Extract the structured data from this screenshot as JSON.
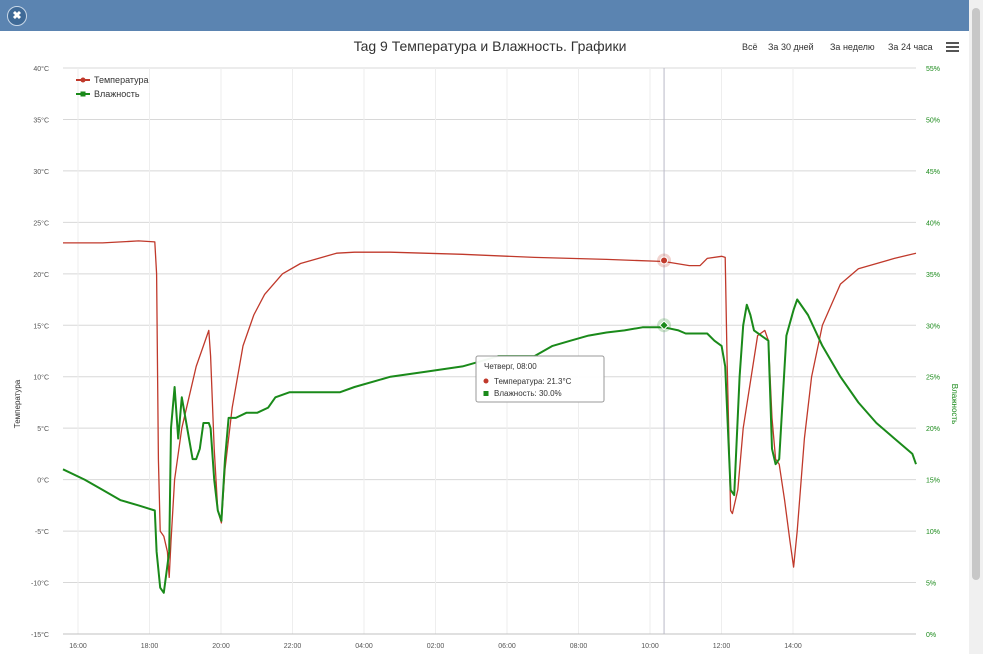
{
  "window": {
    "close_glyph": "✖"
  },
  "toolbar": {
    "range_buttons": [
      "Всё",
      "За 30 дней",
      "За неделю",
      "За 24 часа"
    ],
    "menu_icon": "hamburger-menu-icon"
  },
  "chart_data": {
    "type": "line",
    "title": "Tag 9 Температура и Влажность. Графики",
    "ylabel_left": "Температура",
    "ylabel_right": "Влажность",
    "x_ticks": [
      "16:00",
      "18:00",
      "20:00",
      "22:00",
      "04:00",
      "02:00",
      "06:00",
      "08:00",
      "10:00",
      "12:00",
      "14:00"
    ],
    "y_left": {
      "min": -15,
      "max": 40,
      "step": 5,
      "ticks": [
        "-15°C",
        "-10°C",
        "-5°C",
        "0°C",
        "5°C",
        "10°C",
        "15°C",
        "20°C",
        "25°C",
        "30°C",
        "35°C",
        "40°C"
      ]
    },
    "y_right": {
      "min": 0,
      "max": 55,
      "step": 5,
      "ticks": [
        "0%",
        "5%",
        "10%",
        "15%",
        "20%",
        "25%",
        "30%",
        "35%",
        "40%",
        "45%",
        "50%",
        "55%"
      ]
    },
    "x_range": [
      14.9,
      38.6
    ],
    "grid": true,
    "legend_position": "top-left",
    "series": [
      {
        "name": "Температура",
        "color": "#c0392b",
        "axis": "left",
        "points": [
          [
            14.9,
            23.0
          ],
          [
            16.0,
            23.0
          ],
          [
            17.0,
            23.2
          ],
          [
            17.45,
            23.1
          ],
          [
            17.5,
            20.0
          ],
          [
            17.55,
            2.0
          ],
          [
            17.6,
            -5.0
          ],
          [
            17.7,
            -5.5
          ],
          [
            17.8,
            -7.0
          ],
          [
            17.85,
            -9.5
          ],
          [
            17.9,
            -6.0
          ],
          [
            18.0,
            0.0
          ],
          [
            18.2,
            5.0
          ],
          [
            18.4,
            8.0
          ],
          [
            18.6,
            11.0
          ],
          [
            18.8,
            13.0
          ],
          [
            18.95,
            14.5
          ],
          [
            19.0,
            12.0
          ],
          [
            19.1,
            3.0
          ],
          [
            19.2,
            -3.0
          ],
          [
            19.3,
            -4.2
          ],
          [
            19.4,
            1.0
          ],
          [
            19.6,
            7.0
          ],
          [
            19.9,
            13.0
          ],
          [
            20.2,
            16.0
          ],
          [
            20.5,
            18.0
          ],
          [
            21.0,
            20.0
          ],
          [
            21.5,
            21.0
          ],
          [
            22.0,
            21.5
          ],
          [
            22.5,
            22.0
          ],
          [
            23.0,
            22.1
          ],
          [
            24.0,
            22.1
          ],
          [
            26.0,
            21.9
          ],
          [
            28.0,
            21.6
          ],
          [
            30.0,
            21.4
          ],
          [
            31.6,
            21.2
          ],
          [
            32.3,
            20.8
          ],
          [
            32.6,
            20.8
          ],
          [
            32.8,
            21.5
          ],
          [
            33.2,
            21.7
          ],
          [
            33.3,
            21.6
          ],
          [
            33.35,
            12.0
          ],
          [
            33.45,
            -3.0
          ],
          [
            33.5,
            -3.3
          ],
          [
            33.65,
            -1.0
          ],
          [
            33.8,
            5.0
          ],
          [
            34.0,
            9.5
          ],
          [
            34.2,
            14.0
          ],
          [
            34.4,
            14.5
          ],
          [
            34.5,
            13.5
          ],
          [
            34.6,
            6.0
          ],
          [
            34.7,
            2.0
          ],
          [
            34.8,
            1.5
          ],
          [
            34.95,
            -2.0
          ],
          [
            35.1,
            -6.0
          ],
          [
            35.2,
            -8.5
          ],
          [
            35.3,
            -5.0
          ],
          [
            35.5,
            4.0
          ],
          [
            35.7,
            10.0
          ],
          [
            36.0,
            15.0
          ],
          [
            36.5,
            19.0
          ],
          [
            37.0,
            20.5
          ],
          [
            38.0,
            21.5
          ],
          [
            39.0,
            22.0
          ],
          [
            40.0,
            22.5
          ],
          [
            41.0,
            22.8
          ],
          [
            42.0,
            23.0
          ]
        ]
      },
      {
        "name": "Влажность",
        "color": "#1a8a1a",
        "axis": "right",
        "points": [
          [
            14.9,
            16.0
          ],
          [
            15.5,
            15.0
          ],
          [
            16.0,
            14.0
          ],
          [
            16.5,
            13.0
          ],
          [
            17.0,
            12.5
          ],
          [
            17.45,
            12.0
          ],
          [
            17.5,
            8.0
          ],
          [
            17.6,
            4.5
          ],
          [
            17.7,
            4.0
          ],
          [
            17.85,
            8.0
          ],
          [
            17.9,
            20.0
          ],
          [
            18.0,
            24.0
          ],
          [
            18.1,
            19.0
          ],
          [
            18.2,
            23.0
          ],
          [
            18.35,
            20.0
          ],
          [
            18.5,
            17.0
          ],
          [
            18.6,
            17.0
          ],
          [
            18.7,
            18.0
          ],
          [
            18.8,
            20.5
          ],
          [
            18.95,
            20.5
          ],
          [
            19.0,
            20.0
          ],
          [
            19.1,
            15.0
          ],
          [
            19.2,
            12.0
          ],
          [
            19.3,
            11.0
          ],
          [
            19.4,
            17.0
          ],
          [
            19.5,
            21.0
          ],
          [
            19.7,
            21.0
          ],
          [
            20.0,
            21.5
          ],
          [
            20.3,
            21.5
          ],
          [
            20.6,
            22.0
          ],
          [
            20.8,
            23.0
          ],
          [
            21.2,
            23.5
          ],
          [
            22.0,
            23.5
          ],
          [
            22.6,
            23.5
          ],
          [
            23.0,
            24.0
          ],
          [
            24.0,
            25.0
          ],
          [
            25.0,
            25.5
          ],
          [
            26.0,
            26.0
          ],
          [
            26.5,
            26.5
          ],
          [
            27.0,
            27.0
          ],
          [
            28.0,
            27.0
          ],
          [
            28.5,
            28.0
          ],
          [
            29.0,
            28.5
          ],
          [
            29.5,
            29.0
          ],
          [
            30.0,
            29.3
          ],
          [
            30.5,
            29.5
          ],
          [
            31.0,
            29.8
          ],
          [
            31.6,
            29.8
          ],
          [
            32.0,
            29.5
          ],
          [
            32.2,
            29.2
          ],
          [
            32.5,
            29.2
          ],
          [
            32.8,
            29.2
          ],
          [
            33.0,
            28.5
          ],
          [
            33.2,
            28.0
          ],
          [
            33.3,
            26.0
          ],
          [
            33.45,
            14.0
          ],
          [
            33.55,
            13.5
          ],
          [
            33.7,
            25.0
          ],
          [
            33.8,
            30.0
          ],
          [
            33.9,
            32.0
          ],
          [
            34.0,
            31.0
          ],
          [
            34.1,
            29.5
          ],
          [
            34.3,
            29.0
          ],
          [
            34.5,
            28.5
          ],
          [
            34.6,
            18.0
          ],
          [
            34.7,
            16.5
          ],
          [
            34.8,
            17.0
          ],
          [
            34.9,
            23.0
          ],
          [
            35.0,
            29.0
          ],
          [
            35.2,
            31.5
          ],
          [
            35.3,
            32.5
          ],
          [
            35.6,
            31.0
          ],
          [
            36.0,
            28.0
          ],
          [
            36.5,
            25.0
          ],
          [
            37.0,
            22.5
          ],
          [
            37.5,
            20.5
          ],
          [
            38.0,
            19.0
          ],
          [
            38.5,
            17.5
          ],
          [
            39.0,
            16.5
          ],
          [
            39.5,
            15.5
          ],
          [
            40.0,
            14.5
          ],
          [
            40.5,
            13.8
          ],
          [
            41.0,
            13.2
          ],
          [
            41.5,
            12.5
          ],
          [
            42.0,
            12.0
          ]
        ]
      }
    ],
    "crosshair_x": 31.6,
    "tooltip": {
      "header": "Четверг, 08:00",
      "rows": [
        {
          "series": "Температура",
          "text": "Температура: 21.3°C",
          "color": "#c0392b"
        },
        {
          "series": "Влажность",
          "text": "Влажность: 30.0%",
          "color": "#1a8a1a"
        }
      ]
    },
    "markers": [
      {
        "series": "Температура",
        "x": 31.6,
        "y": 21.3
      },
      {
        "series": "Влажность",
        "x": 31.6,
        "y": 30.0
      }
    ]
  }
}
